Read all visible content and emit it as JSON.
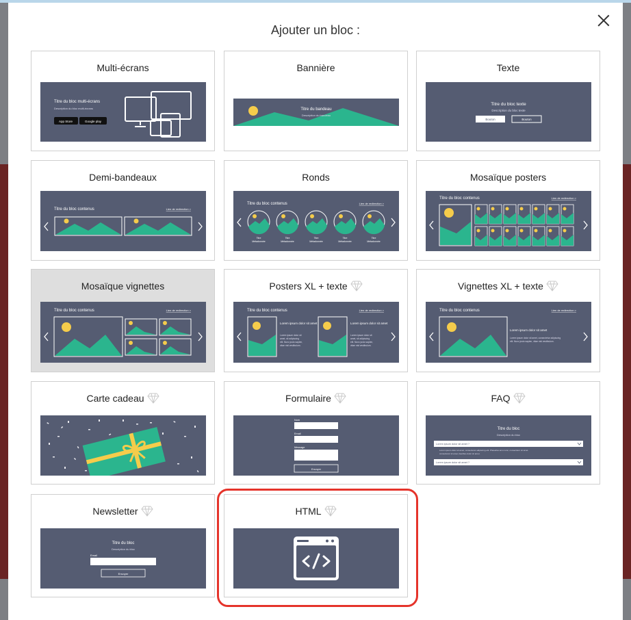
{
  "dialog": {
    "title": "Ajouter un bloc :",
    "close_label": "×"
  },
  "blocks": [
    {
      "title": "Multi-écrans",
      "premium": false
    },
    {
      "title": "Bannière",
      "premium": false
    },
    {
      "title": "Texte",
      "premium": false
    },
    {
      "title": "Demi-bandeaux",
      "premium": false
    },
    {
      "title": "Ronds",
      "premium": false
    },
    {
      "title": "Mosaïque posters",
      "premium": false
    },
    {
      "title": "Mosaïque vignettes",
      "premium": false,
      "selected": true
    },
    {
      "title": "Posters XL + texte",
      "premium": true
    },
    {
      "title": "Vignettes XL + texte",
      "premium": true
    },
    {
      "title": "Carte cadeau",
      "premium": true
    },
    {
      "title": "Formulaire",
      "premium": true
    },
    {
      "title": "FAQ",
      "premium": true
    },
    {
      "title": "Newsletter",
      "premium": true
    },
    {
      "title": "HTML",
      "premium": true,
      "highlighted": true
    }
  ],
  "thumbs": {
    "multi": {
      "title": "Titre du bloc multi-écrans",
      "desc": "Description du bloc multi-écrans",
      "appstore": "App Store",
      "googleplay": "Google play"
    },
    "banner": {
      "title": "Titre du bandeau",
      "desc": "Description du bandeau"
    },
    "text": {
      "title": "Titre du bloc texte",
      "desc": "Description du bloc texte",
      "btn1": "Bouton",
      "btn2": "Bouton"
    },
    "half": {
      "title": "Titre du bloc contenus",
      "link": "Lien de redirection >"
    },
    "rounds": {
      "title": "Titre du bloc contenus",
      "link": "Lien de redirection >",
      "item_line1": "Titre",
      "item_line2": "Métadonnée"
    },
    "mosaic_posters": {
      "title": "Titre du bloc contenus",
      "link": "Lien de redirection >"
    },
    "mosaic_vignettes": {
      "title": "Titre du bloc contenus",
      "link": "Lien de redirection >"
    },
    "posters_xl": {
      "title": "Titre du bloc contenus",
      "link": "Lien de redirection >",
      "lorem_title": "Lorem ipsum dolor sit amet",
      "lorem_body": "Lorem ipsum dolor sit amet, sit adipiscing elit. Nunc justo sapien, vitae nisl vestibulum."
    },
    "vignettes_xl": {
      "title": "Titre du bloc contenus",
      "link": "Lien de redirection >",
      "lorem_title": "Lorem ipsum dolor sit amet",
      "lorem_body": "Lorem ipsum dolor sit amet, consectetur adipiscing elit. Nunc justo sapien, vitae nisl vestibulum."
    },
    "form": {
      "name": "Nom",
      "email": "Email",
      "message": "Message",
      "submit": "Envoyer"
    },
    "faq": {
      "title": "Titre du bloc",
      "desc": "Description du bloc",
      "q1": "Lorem ipsum dolor sit amet ?",
      "a1": "Lorem ipsum dolor sit amet, consectetur adipiscing elit. Phasellus arcu nunc, consectetur sit amet.",
      "q2": "Lorem ipsum dolor sit amet ?"
    },
    "newsletter": {
      "title": "Titre du bloc",
      "desc": "Description du bloc",
      "email": "Email",
      "submit": "Envoyer"
    }
  },
  "colors": {
    "thumb_bg": "#555c72",
    "accent_green": "#2bb58e",
    "sun_yellow": "#f5cc4b",
    "highlight_red": "#e5332a",
    "selected_bg": "#dedede"
  },
  "icons": {
    "close": "close-icon",
    "premium": "diamond-icon",
    "html": "code-window-icon"
  }
}
